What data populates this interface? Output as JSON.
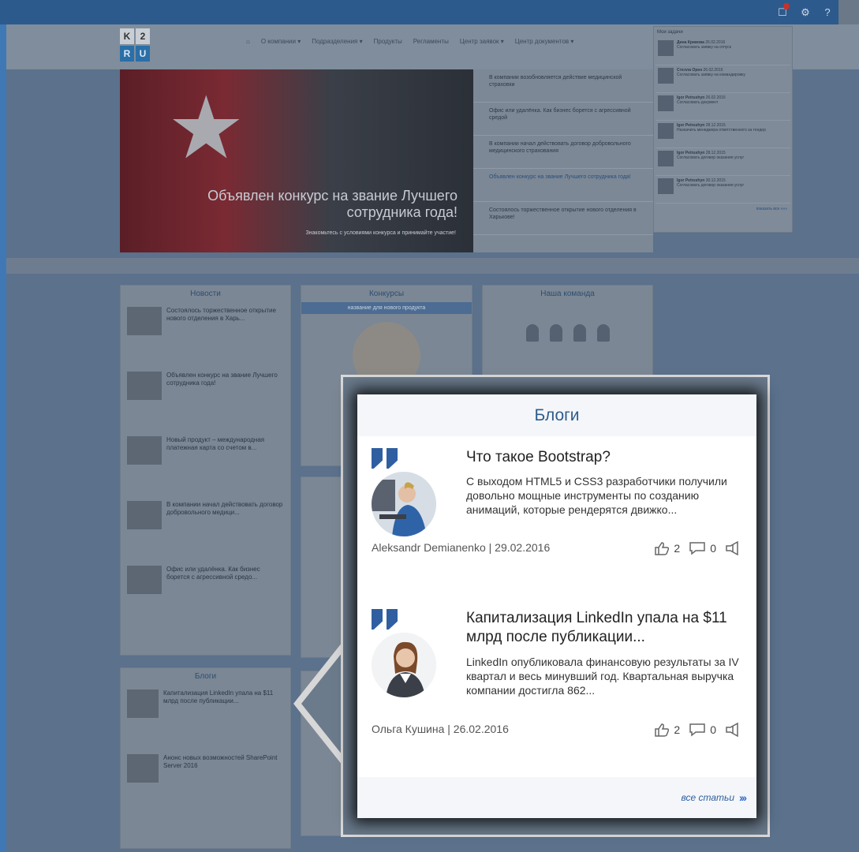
{
  "topbar": {
    "icons": [
      "tasks-icon",
      "gear-icon",
      "help-icon",
      "user-avatar"
    ]
  },
  "logo": {
    "letters": [
      "K",
      "2",
      "R",
      "U"
    ]
  },
  "nav": {
    "items": [
      "О компании ▾",
      "Подразделения ▾",
      "Продукты",
      "Регламенты",
      "Центр заявок ▾",
      "Центр документов ▾"
    ]
  },
  "hero": {
    "title": "Объявлен конкурс на звание Лучшего сотрудника года!",
    "subtitle": "Знакомьтесь с условиями конкурса и принимайте участие!"
  },
  "news_list": [
    "В компании возобновляется действие медицинской страховки",
    "Офис или удалёнка. Как бизнес борется с агрессивной средой",
    "В компании начал действовать договор добровольного медицинского страхования",
    "Объявлен конкурс на звание Лучшего сотрудника года!",
    "Состоялось торжественное открытие нового отделения в Харькове!"
  ],
  "tasks": {
    "header": "Мои задачи",
    "items": [
      {
        "name": "Дина Кривова",
        "text": "Согласовать заявку на отпуск",
        "date": "26.02.2016"
      },
      {
        "name": "Стелла Орен",
        "text": "Согласовать заявку на командировку",
        "date": "26.02.2016"
      },
      {
        "name": "Igor Petrushyn",
        "text": "Согласовать документ",
        "date": "26.02.2016"
      },
      {
        "name": "Igor Petrushyn",
        "text": "Назначить менеджера ответственного за тендер",
        "date": "28.12.2015"
      },
      {
        "name": "Igor Petrushyn",
        "text": "Согласовать договор оказания услуг",
        "date": "28.12.2015"
      },
      {
        "name": "Igor Petrushyn",
        "text": "Согласовать договор оказания услуг",
        "date": "30.12.2015"
      }
    ],
    "footer": "показать все »»»"
  },
  "widgets": {
    "news_title": "Новости",
    "news": [
      "Состоялось торжественное открытие нового отделения в Харь...",
      "Объявлен конкурс на звание Лучшего сотрудника года!",
      "Новый продукт – международная платежная карта со счетом в...",
      "В компании начал действовать договор добровольного медици...",
      "Офис или удалёнка. Как бизнес борется с агрессивной средо..."
    ],
    "contests_title": "Конкурсы",
    "contests_sub": "название для нового продукта",
    "team_title": "Наша команда",
    "blogs_small_title": "Блоги",
    "blogs_small": [
      "Капитализация LinkedIn упала на $11 млрд после публикации...",
      "Анонс новых возможностей SharePoint Server 2016"
    ]
  },
  "blogs": {
    "title": "Блоги",
    "posts": [
      {
        "title": "Что такое Bootstrap?",
        "excerpt": "С выходом HTML5 и CSS3 разработчики получили довольно мощные инструменты по созданию анимаций, которые рендерятся движко...",
        "author": "Aleksandr Demianenko | 29.02.2016",
        "likes": "2",
        "comments": "0"
      },
      {
        "title": "Капитализация LinkedIn упала на $11 млрд после публикации...",
        "excerpt": "LinkedIn опубликовала финансовую результаты за IV квартал и весь минувший год. Квартальная выручка компании достигла 862...",
        "author": "Ольга Кушина | 26.02.2016",
        "likes": "2",
        "comments": "0"
      }
    ],
    "all_label": "все статьи",
    "all_arrows": "›››"
  }
}
